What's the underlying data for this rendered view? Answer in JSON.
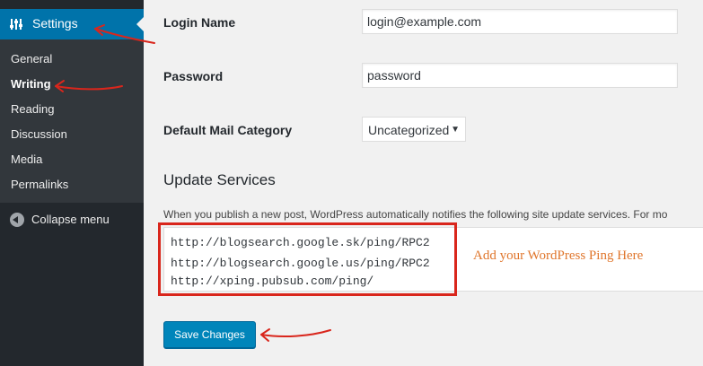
{
  "sidebar": {
    "settings_label": "Settings",
    "items": [
      {
        "label": "General"
      },
      {
        "label": "Writing"
      },
      {
        "label": "Reading"
      },
      {
        "label": "Discussion"
      },
      {
        "label": "Media"
      },
      {
        "label": "Permalinks"
      }
    ],
    "active": "Writing",
    "collapse_label": "Collapse menu"
  },
  "form": {
    "login_label": "Login Name",
    "login_value": "login@example.com",
    "password_label": "Password",
    "password_value": "password",
    "category_label": "Default Mail Category",
    "category_value": "Uncategorized"
  },
  "update_services": {
    "title": "Update Services",
    "description": "When you publish a new post, WordPress automatically notifies the following site update services. For mo",
    "lines": [
      "http://blogsearch.google.sk/ping/RPC2",
      "http://blogsearch.google.us/ping/RPC2",
      "http://xping.pubsub.com/ping/"
    ],
    "annotation": "Add your WordPress Ping Here"
  },
  "save_label": "Save Changes",
  "colors": {
    "sidebar_bg": "#23282d",
    "accent": "#0073aa",
    "annotation_red": "#d9261c",
    "note_orange": "#e0762c"
  }
}
